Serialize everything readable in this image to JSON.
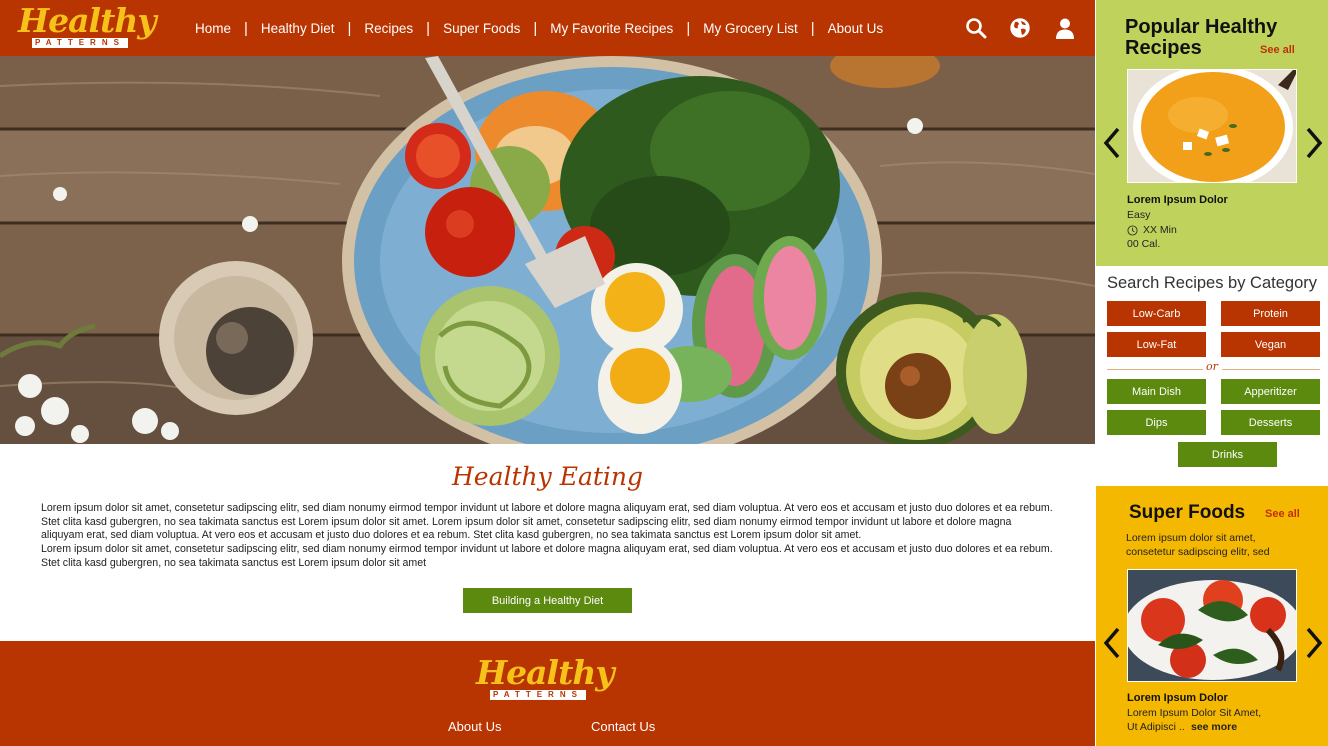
{
  "header": {
    "logo": {
      "main": "Healthy",
      "sub": "PATTERNS"
    },
    "nav": [
      {
        "label": "Home"
      },
      {
        "label": "Healthy Diet"
      },
      {
        "label": "Recipes"
      },
      {
        "label": "Super Foods"
      },
      {
        "label": "My Favorite Recipes"
      },
      {
        "label": "My Grocery List"
      },
      {
        "label": "About Us"
      }
    ],
    "icons": [
      "search-icon",
      "globe-icon",
      "user-icon"
    ]
  },
  "hero": {
    "image": "salad-bowl-photo"
  },
  "healthy_eating": {
    "title": "Healthy Eating",
    "paragraph_1": "Lorem ipsum dolor sit amet, consetetur sadipscing elitr, sed diam nonumy eirmod tempor invidunt ut labore et dolore magna aliquyam erat, sed diam voluptua. At vero eos et accusam et justo duo dolores et ea rebum. Stet clita kasd gubergren, no sea takimata sanctus est Lorem ipsum dolor sit amet. Lorem ipsum dolor sit amet, consetetur sadipscing elitr, sed diam nonumy eirmod tempor invidunt ut labore et dolore magna aliquyam erat, sed diam voluptua. At vero eos et accusam et justo duo dolores et ea rebum. Stet clita kasd gubergren, no sea takimata sanctus est Lorem ipsum dolor sit amet.",
    "paragraph_2": "Lorem ipsum dolor sit amet, consetetur sadipscing elitr, sed diam nonumy eirmod tempor invidunt ut labore et dolore magna aliquyam erat, sed diam voluptua. At vero eos et accusam et justo duo dolores et ea rebum. Stet clita kasd gubergren, no sea takimata sanctus est Lorem ipsum dolor sit amet",
    "button": "Building a Healthy Diet"
  },
  "footer": {
    "logo": {
      "main": "Healthy",
      "sub": "PATTERNS"
    },
    "links": [
      "About Us",
      "Contact Us"
    ]
  },
  "sidebar": {
    "popular": {
      "title_line1": "Popular Healthy",
      "title_line2": "Recipes",
      "see_all": "See all",
      "card": {
        "title": "Lorem Ipsum Dolor",
        "difficulty": "Easy",
        "time": "XX Min",
        "calories": "00 Cal."
      }
    },
    "category": {
      "title": "Search Recipes by Category",
      "diet": [
        "Low-Carb",
        "Protein",
        "Low-Fat",
        "Vegan"
      ],
      "or": "or",
      "meal": [
        "Main Dish",
        "Apperitizer",
        "Dips",
        "Desserts",
        "Drinks"
      ]
    },
    "super_foods": {
      "title": "Super Foods",
      "see_all": "See all",
      "intro_line1": "Lorem ipsum dolor sit amet,",
      "intro_line2": "consetetur sadipscing elitr, sed",
      "card": {
        "title": "Lorem Ipsum Dolor",
        "line1": "Lorem Ipsum Dolor Sit Amet,",
        "line2": "Ut Adipisci ..",
        "see_more": "see more"
      }
    }
  },
  "colors": {
    "brand_red": "#b83400",
    "logo_yellow": "#f6c21a",
    "lime": "#bfd35c",
    "gold": "#f5b800",
    "green_button": "#5b8a0f"
  }
}
